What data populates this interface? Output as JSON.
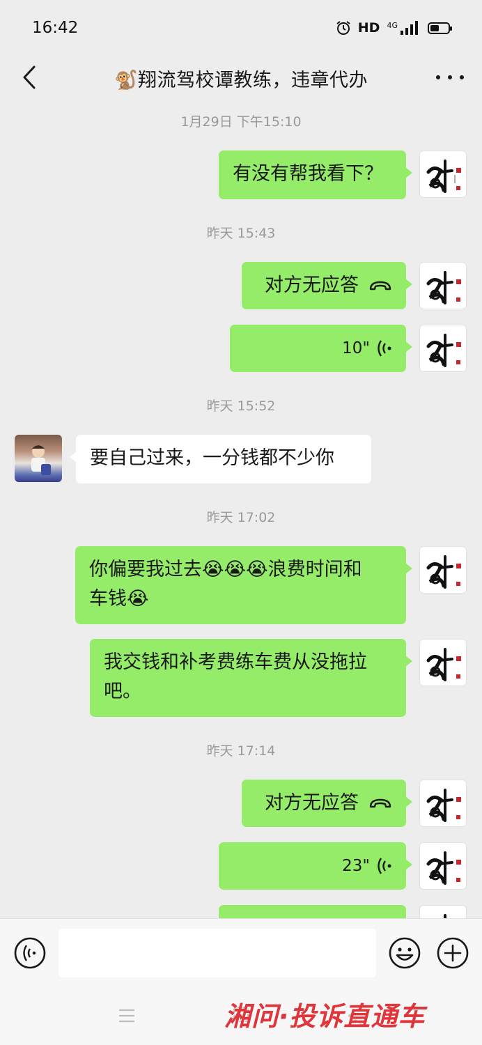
{
  "status_bar": {
    "time": "16:42",
    "hd": "HD",
    "network": "4G",
    "icons": [
      "alarm-icon",
      "signal-icon",
      "battery-icon"
    ]
  },
  "header": {
    "title": "🐒翔流驾校谭教练，违章代办",
    "back_icon": "chevron-left-icon",
    "more_icon": "more-dots-icon"
  },
  "messages": [
    {
      "type": "timestamp",
      "text": "1月29日 下午15:10"
    },
    {
      "type": "text",
      "sender": "self",
      "text": "有没有帮我看下？"
    },
    {
      "type": "timestamp",
      "text": "昨天 15:43"
    },
    {
      "type": "call",
      "sender": "self",
      "text": "对方无应答",
      "icon": "phone-hangup-icon"
    },
    {
      "type": "voice",
      "sender": "self",
      "duration": "10\"",
      "icon": "voice-wave-icon"
    },
    {
      "type": "timestamp",
      "text": "昨天 15:52"
    },
    {
      "type": "text",
      "sender": "other",
      "text": "要自己过来，一分钱都不少你"
    },
    {
      "type": "timestamp",
      "text": "昨天 17:02"
    },
    {
      "type": "text",
      "sender": "self",
      "lines": [
        "你偏要我过去😭😭😭浪费时间和",
        "车钱😭"
      ]
    },
    {
      "type": "text",
      "sender": "self",
      "lines": [
        "我交钱和补考费练车费从没拖拉",
        "吧。"
      ]
    },
    {
      "type": "timestamp",
      "text": "昨天 17:14"
    },
    {
      "type": "call",
      "sender": "self",
      "text": "对方无应答",
      "icon": "phone-hangup-icon"
    },
    {
      "type": "voice",
      "sender": "self",
      "duration": "23\"",
      "icon": "voice-wave-icon"
    }
  ],
  "input_bar": {
    "voice_icon": "voice-mode-icon",
    "input_value": "",
    "emoji_icon": "emoji-icon",
    "plus_icon": "plus-icon"
  },
  "bottom_nav": {
    "icons": [
      "menu-icon",
      "home-icon",
      "back-triangle-icon"
    ]
  },
  "watermark": "湘问·投诉直通车",
  "colors": {
    "self_bubble": "#95ec69",
    "other_bubble": "#ffffff",
    "background": "#ededed",
    "watermark": "#e0353a"
  }
}
